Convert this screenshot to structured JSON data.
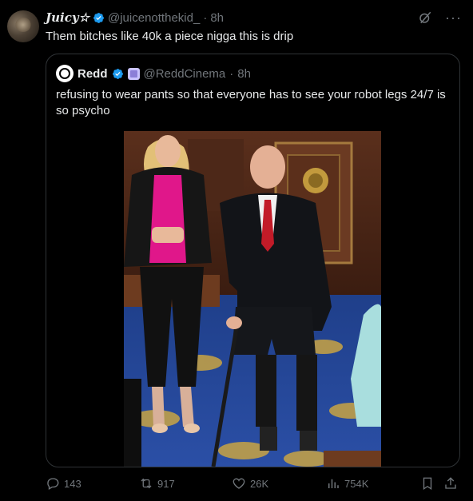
{
  "post": {
    "author_name": "Juicy☆",
    "handle": "@juicenotthekid_",
    "separator": "·",
    "time": "8h",
    "text": "Them bitches like 40k a piece nigga this is drip"
  },
  "quoted_post": {
    "author_name": "Redd",
    "handle": "@ReddCinema",
    "separator": "·",
    "time": "8h",
    "text": "refusing to wear pants so that everyone has to see your robot legs 24/7 is so psycho"
  },
  "actions": {
    "replies": "143",
    "reposts": "917",
    "likes": "26K",
    "views": "754K"
  },
  "icons": [
    "verified-badge-icon",
    "grok-icon",
    "more-icon",
    "reply-icon",
    "repost-icon",
    "like-icon",
    "views-icon",
    "bookmark-icon",
    "share-icon"
  ],
  "colors": {
    "background": "#000000",
    "text": "#e7e9ea",
    "muted": "#71767b",
    "verified": "#1d9bf0",
    "border": "#2f3336"
  }
}
